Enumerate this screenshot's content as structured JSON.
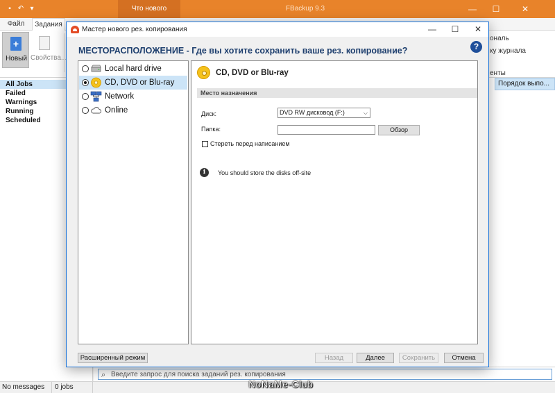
{
  "app": {
    "tab_title": "Что нового",
    "window_title": "FBackup 9.3",
    "window_controls": {
      "minimize": "—",
      "maximize": "☐",
      "close": "✕"
    }
  },
  "ribbon": {
    "tabs": [
      "Файл",
      "Задания"
    ],
    "new_label": "Новый",
    "properties_label": "Свойства...",
    "right_fragments": [
      "ональ",
      "ку журнала",
      "енты"
    ]
  },
  "jobs": {
    "items": [
      "All Jobs",
      "Failed",
      "Warnings",
      "Running",
      "Scheduled"
    ],
    "selected": "All Jobs"
  },
  "table": {
    "column_header": "Порядок выпо..."
  },
  "search": {
    "placeholder": "Введите запрос для поиска заданий рез. копирования"
  },
  "status": {
    "messages": "No messages",
    "jobs": "0 jobs"
  },
  "watermark": "NoNaMe-Club",
  "dialog": {
    "title": "Мастер нового рез. копирования",
    "heading": "МЕСТОРАСПОЛОЖЕНИЕ - Где вы хотите сохранить ваше рез. копирование?",
    "help": "?",
    "locations": [
      {
        "label": "Local hard drive",
        "icon": "hard-drive-icon",
        "selected": false
      },
      {
        "label": "CD, DVD or Blu-ray",
        "icon": "disc-icon",
        "selected": true
      },
      {
        "label": "Network",
        "icon": "network-icon",
        "selected": false
      },
      {
        "label": "Online",
        "icon": "cloud-icon",
        "selected": false
      }
    ],
    "detail": {
      "title": "CD, DVD or Blu-ray",
      "section": "Место назначения",
      "disk_label": "Диск:",
      "disk_value": "DVD RW дисковод (F:)",
      "folder_label": "Папка:",
      "folder_value": "",
      "browse_label": "Обзор",
      "erase_label": "Стереть перед написанием",
      "erase_checked": false,
      "info": "You should store the disks off-site"
    },
    "buttons": {
      "advanced": "Расширенный режим",
      "back": "Назад",
      "next": "Далее",
      "save": "Сохранить",
      "cancel": "Отмена"
    }
  }
}
